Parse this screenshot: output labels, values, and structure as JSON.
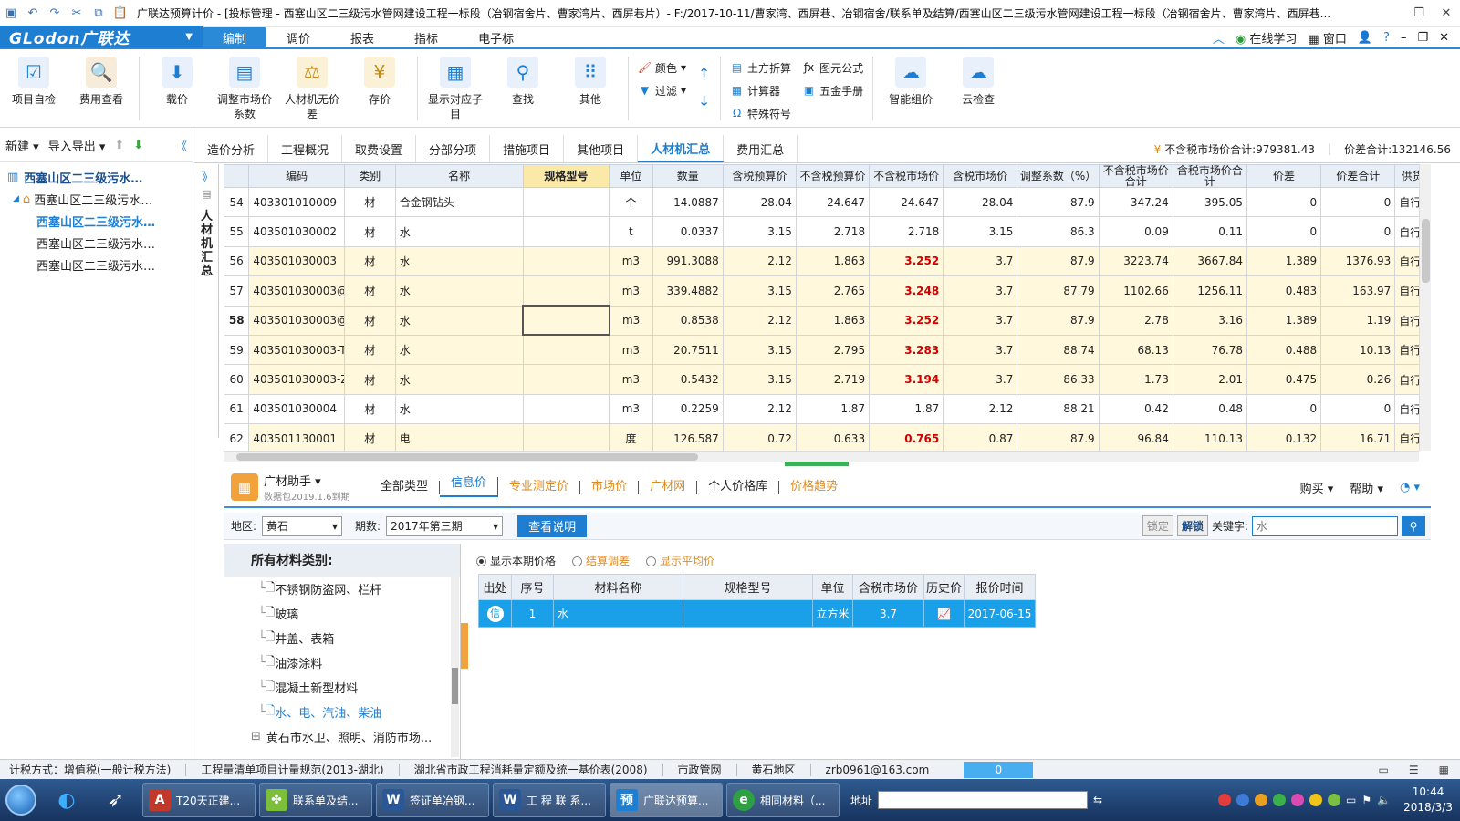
{
  "window": {
    "title": "广联达预算计价 - [投标管理 - 西塞山区二三级污水管网建设工程一标段（冶钢宿舍片、曹家湾片、西屏巷片）- F:/2017-10-11/曹家湾、西屏巷、冶钢宿舍/联系单及结算/西塞山区二三级污水管网建设工程一标段（冶钢宿舍片、曹家湾片、西屏巷..."
  },
  "menu": {
    "logo": "GLodon广联达",
    "tabs": [
      "编制",
      "调价",
      "报表",
      "指标",
      "电子标"
    ],
    "online": "在线学习",
    "window_menu": "窗口"
  },
  "ribbon": {
    "b1": "项目自检",
    "b2": "费用查看",
    "b3": "载价",
    "b4": "调整市场价系数",
    "b5": "人材机无价差",
    "b6": "存价",
    "b7": "显示对应子目",
    "b8": "查找",
    "b9": "其他",
    "s_color": "颜色",
    "s_filter": "过滤",
    "s_earth": "土方折算",
    "s_calc": "计算器",
    "s_symbol": "特殊符号",
    "s_formula": "图元公式",
    "s_handbook": "五金手册",
    "b10": "智能组价",
    "b11": "云检查"
  },
  "left": {
    "new": "新建",
    "import": "导入导出",
    "tree": [
      "西塞山区二三级污水…",
      "西塞山区二三级污水…",
      "西塞山区二三级污水…",
      "西塞山区二三级污水…",
      "西塞山区二三级污水…"
    ]
  },
  "vtab": "人材机汇总",
  "tabs2": [
    "造价分析",
    "工程概况",
    "取费设置",
    "分部分项",
    "措施项目",
    "其他项目",
    "人材机汇总",
    "费用汇总"
  ],
  "totals": {
    "market": "不含税市场价合计:979381.43",
    "diff": "价差合计:132146.56"
  },
  "grid": {
    "headers": [
      "编码",
      "类别",
      "名称",
      "规格型号",
      "单位",
      "数量",
      "含税预算价",
      "不含税预算价",
      "不含税市场价",
      "含税市场价",
      "调整系数（%）",
      "不含税市场价合计",
      "含税市场价合计",
      "价差",
      "价差合计",
      "供货"
    ],
    "rows": [
      [
        "54",
        "403301010009",
        "材",
        "合金钢钻头",
        "",
        "个",
        "14.0887",
        "28.04",
        "24.647",
        "24.647",
        "28.04",
        "87.9",
        "347.24",
        "395.05",
        "0",
        "0",
        "自行"
      ],
      [
        "55",
        "403501030002",
        "材",
        "水",
        "",
        "t",
        "0.0337",
        "3.15",
        "2.718",
        "2.718",
        "3.15",
        "86.3",
        "0.09",
        "0.11",
        "0",
        "0",
        "自行"
      ],
      [
        "56",
        "403501030003",
        "材",
        "水",
        "",
        "m3",
        "991.3088",
        "2.12",
        "1.863",
        "3.252",
        "3.7",
        "87.9",
        "3223.74",
        "3667.84",
        "1.389",
        "1376.93",
        "自行"
      ],
      [
        "57",
        "403501030003@1",
        "材",
        "水",
        "",
        "m3",
        "339.4882",
        "3.15",
        "2.765",
        "3.248",
        "3.7",
        "87.79",
        "1102.66",
        "1256.11",
        "0.483",
        "163.97",
        "自行"
      ],
      [
        "58",
        "403501030003@2",
        "材",
        "水",
        "",
        "m3",
        "0.8538",
        "2.12",
        "1.863",
        "3.252",
        "3.7",
        "87.9",
        "2.78",
        "3.16",
        "1.389",
        "1.19",
        "自行"
      ],
      [
        "59",
        "403501030003-T",
        "材",
        "水",
        "",
        "m3",
        "20.7511",
        "3.15",
        "2.795",
        "3.283",
        "3.7",
        "88.74",
        "68.13",
        "76.78",
        "0.488",
        "10.13",
        "自行"
      ],
      [
        "60",
        "403501030003-Z",
        "材",
        "水",
        "",
        "m3",
        "0.5432",
        "3.15",
        "2.719",
        "3.194",
        "3.7",
        "86.33",
        "1.73",
        "2.01",
        "0.475",
        "0.26",
        "自行"
      ],
      [
        "61",
        "403501030004",
        "材",
        "水",
        "",
        "m3",
        "0.2259",
        "2.12",
        "1.87",
        "1.87",
        "2.12",
        "88.21",
        "0.42",
        "0.48",
        "0",
        "0",
        "自行"
      ],
      [
        "62",
        "403501130001",
        "材",
        "电",
        "",
        "度",
        "126.587",
        "0.72",
        "0.633",
        "0.765",
        "0.87",
        "87.9",
        "96.84",
        "110.13",
        "0.132",
        "16.71",
        "自行"
      ]
    ]
  },
  "helper": {
    "name": "广材助手",
    "sub": "数据包2019.1.6到期",
    "tabs": [
      "全部类型",
      "信息价",
      "专业测定价",
      "市场价",
      "广材网",
      "个人价格库",
      "价格趋势"
    ],
    "buy": "购买",
    "help": "帮助"
  },
  "filter": {
    "region_label": "地区:",
    "region": "黄石",
    "period_label": "期数:",
    "period": "2017年第三期",
    "explain": "查看说明",
    "lock": "锁定",
    "unlock": "解锁",
    "keyword_label": "关键字:",
    "keyword": "水"
  },
  "categories": {
    "title": "所有材料类别:",
    "items": [
      "不锈钢防盗网、栏杆",
      "玻璃",
      "井盖、表箱",
      "油漆涂料",
      "混凝土新型材料",
      "水、电、汽油、柴油",
      "黄石市水卫、照明、消防市场..."
    ]
  },
  "price_opts": [
    "显示本期价格",
    "结算调差",
    "显示平均价"
  ],
  "ptable": {
    "headers": [
      "出处",
      "序号",
      "材料名称",
      "规格型号",
      "单位",
      "含税市场价",
      "历史价",
      "报价时间"
    ],
    "row": [
      "信",
      "1",
      "水",
      "",
      "立方米",
      "3.7",
      "",
      "2017-06-15"
    ]
  },
  "status": {
    "items": [
      "计税方式：增值税(一般计税方法)",
      "工程量清单项目计量规范(2013-湖北)",
      "湖北省市政工程消耗量定额及统一基价表(2008)",
      "市政管网",
      "黄石地区",
      "zrb0961@163.com"
    ],
    "count": "0"
  },
  "taskbar": {
    "tasks": [
      "T20天正建...",
      "联系单及结...",
      "签证单冶钢...",
      "工 程 联 系...",
      "广联达预算...",
      "相同材料（..."
    ],
    "addr": "地址",
    "time": "10:44",
    "date": "2018/3/3"
  },
  "colors": {
    "accent": "#1e7fd2",
    "red_value": "#d00000",
    "highlight_row": "#fff8dc"
  }
}
